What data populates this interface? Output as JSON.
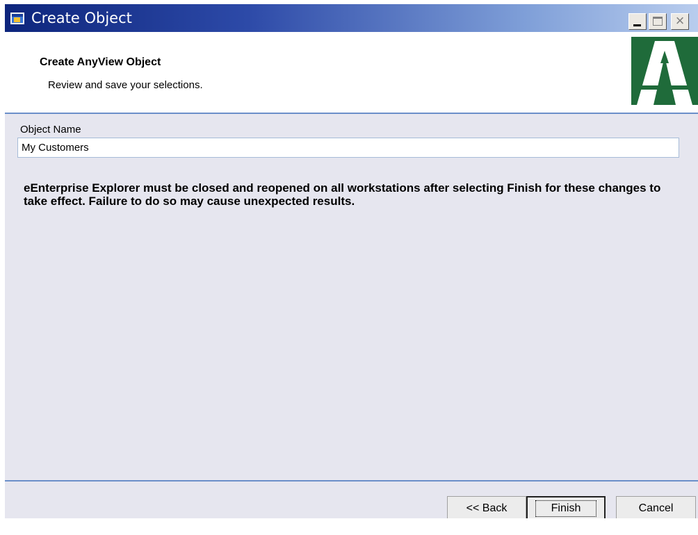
{
  "window": {
    "title": "Create Object",
    "controls": {
      "minimize": "minimize",
      "maximize": "maximize",
      "close": "×"
    }
  },
  "header": {
    "title": "Create AnyView Object",
    "subtitle": "Review and save your selections.",
    "logo_icon": "road-logo-icon",
    "logo_colors": {
      "green": "#1f6b3a",
      "white": "#ffffff"
    }
  },
  "form": {
    "object_name_label": "Object Name",
    "object_name_value": "My Customers"
  },
  "warning": {
    "text": "eEnterprise Explorer must be closed and reopened on all workstations after selecting Finish for these changes to take effect. Failure to do so may cause unexpected results."
  },
  "buttons": {
    "back": "<< Back",
    "finish": "Finish",
    "cancel": "Cancel"
  },
  "colors": {
    "title_bar_start": "#0d257c",
    "title_bar_end": "#b9cdee",
    "panel_background": "#e6e6ef",
    "separator": "#6b8fc9"
  }
}
